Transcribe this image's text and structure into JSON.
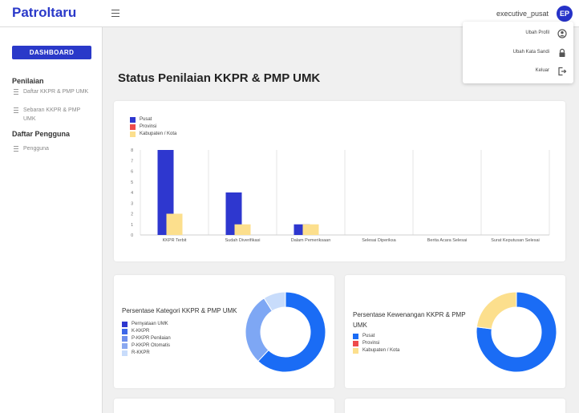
{
  "app": {
    "brand": "Patroltaru"
  },
  "header": {
    "username": "executive_pusat",
    "avatar_initials": "EP"
  },
  "user_menu": {
    "items": [
      {
        "label": "Ubah Profil",
        "icon": "user-circle-icon"
      },
      {
        "label": "Ubah Kata Sandi",
        "icon": "lock-icon"
      },
      {
        "label": "Keluar",
        "icon": "logout-icon"
      }
    ]
  },
  "sidebar": {
    "dashboard_label": "DASHBOARD",
    "sections": [
      {
        "title": "Penilaian",
        "items": [
          "Daftar KKPR & PMP UMK",
          "Sebaran KKPR & PMP UMK"
        ]
      },
      {
        "title": "Daftar Pengguna",
        "items": [
          "Pengguna"
        ]
      }
    ]
  },
  "page": {
    "title": "Status Penilaian KKPR & PMP UMK"
  },
  "colors": {
    "brand": "#2a39c9",
    "pusat": "#2e37cf",
    "provinsi": "#ee4b4b",
    "kab_kota": "#fcdf8d",
    "donut_blue": "#1a6cf5",
    "donut_mid": "#7ea7f4",
    "donut_light": "#c8dcfb"
  },
  "chart_data": [
    {
      "type": "bar",
      "categories": [
        "KKPR Terbit",
        "Sudah Diverifikasi",
        "Dalam Pemeriksaan",
        "Selesai Diperiksa",
        "Berita Acara Selesai",
        "Surat Keputusan Selesai"
      ],
      "series": [
        {
          "name": "Pusat",
          "values": [
            8,
            4,
            1,
            0,
            0,
            0
          ]
        },
        {
          "name": "Provinsi",
          "values": [
            0,
            0,
            0,
            0,
            0,
            0
          ]
        },
        {
          "name": "Kabupaten / Kota",
          "values": [
            2,
            1,
            1,
            0,
            0,
            0
          ]
        }
      ],
      "yticks": [
        "0",
        "1",
        "2",
        "3",
        "4",
        "5",
        "6",
        "7",
        "8"
      ],
      "ylim": [
        0,
        8
      ],
      "legend": "top-left",
      "grid": "vertical"
    },
    {
      "type": "pie",
      "title": "Persentase Kategori KKPR & PMP UMK",
      "labels": [
        "Pernyataan UMK",
        "K-KKPR",
        "P-KKPR Penilaian",
        "P-KKPR Otomatis",
        "R-KKPR"
      ],
      "values": [
        0,
        62,
        29,
        0,
        9
      ],
      "legend_colors": [
        "#2e37cf",
        "#3d67e8",
        "#6f8fec",
        "#8aa8f0",
        "#c8dcfb"
      ],
      "slice_colors": [
        "#2e37cf",
        "#1a6cf5",
        "#7ea7f4",
        "#8aa8f0",
        "#c8dcfb"
      ]
    },
    {
      "type": "pie",
      "title": "Persentase Kewenangan KKPR & PMP UMK",
      "labels": [
        "Pusat",
        "Provinsi",
        "Kabupaten / Kota"
      ],
      "values": [
        77,
        0,
        23
      ],
      "legend_colors": [
        "#1a6cf5",
        "#ee4b4b",
        "#fcdf8d"
      ],
      "slice_colors": [
        "#1a6cf5",
        "#ee4b4b",
        "#fcdf8d"
      ]
    }
  ]
}
